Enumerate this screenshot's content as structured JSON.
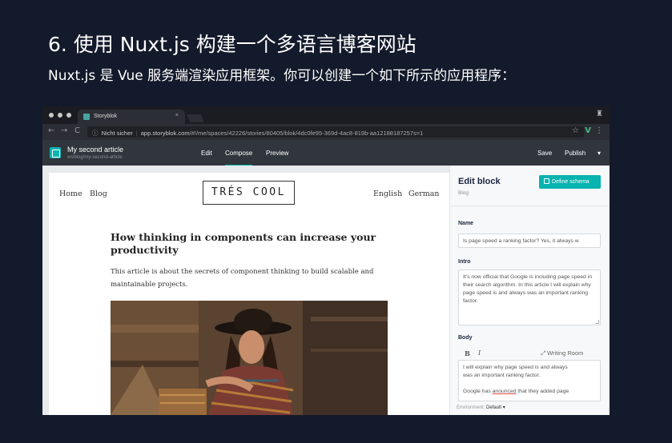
{
  "slide": {
    "title": "6. 使用 Nuxt.js 构建一个多语言博客网站",
    "subtitle": "Nuxt.js 是 Vue 服务端渲染应用框架。你可以创建一个如下所示的应用程序："
  },
  "browser": {
    "tab_title": "Storyblok",
    "tab_close": "×",
    "nav_back": "←",
    "nav_forward": "→",
    "nav_reload": "C",
    "url_info": "ⓘ",
    "url_warning": "Nicht sicher",
    "url_separator": "|",
    "url_domain": "app.storyblok.com",
    "url_path": "/#!/me/spaces/42226/stories/80405/blok/4dc0fe95-369d-4ac8-819b-aa12188187257s=1",
    "star_icon": "☆",
    "vue_icon": "V",
    "menu_icon": "⋮",
    "incognito_icon": "♜"
  },
  "app_header": {
    "story_name": "My second article",
    "story_slug": "en/blog/my-second-article",
    "nav": [
      "Edit",
      "Compose",
      "Preview"
    ],
    "active_nav": "Compose",
    "save": "Save",
    "publish": "Publish",
    "publish_caret": "▾"
  },
  "preview": {
    "nav_left": [
      "Home",
      "Blog"
    ],
    "logo": "TRÉS COOL",
    "nav_right": [
      "English",
      "German"
    ],
    "article_title": "How thinking in components can increase your productivity",
    "article_desc": "This article is about the secrets of component thinking to build scalable and maintainable projects."
  },
  "editor": {
    "title": "Edit block",
    "subtitle": "Blog",
    "define_schema": "Define schema",
    "name_label": "Name",
    "name_value": "Is page speed a ranking factor? Yes, it always w",
    "intro_label": "Intro",
    "intro_value": "It's now official that Google is including page speed in their search algorithm. In this article I will explain why page speed is and always was an important ranking factor.",
    "body_label": "Body",
    "bold_btn": "B",
    "italic_btn": "I",
    "writing_room_icon": "⤢",
    "writing_room": "Writing Room",
    "body_line1": "I will explain why page speed is and always",
    "body_line2": "was an important ranking factor.",
    "body_line3_pre": "Google has ",
    "body_line3_err": "anounced",
    "body_line3_post": " that they added page",
    "env_label": "Environment:",
    "env_value": "Default ▾"
  },
  "colors": {
    "accent": "#09b3af",
    "header_bg": "#30363c",
    "slide_bg": "#131a2b"
  }
}
